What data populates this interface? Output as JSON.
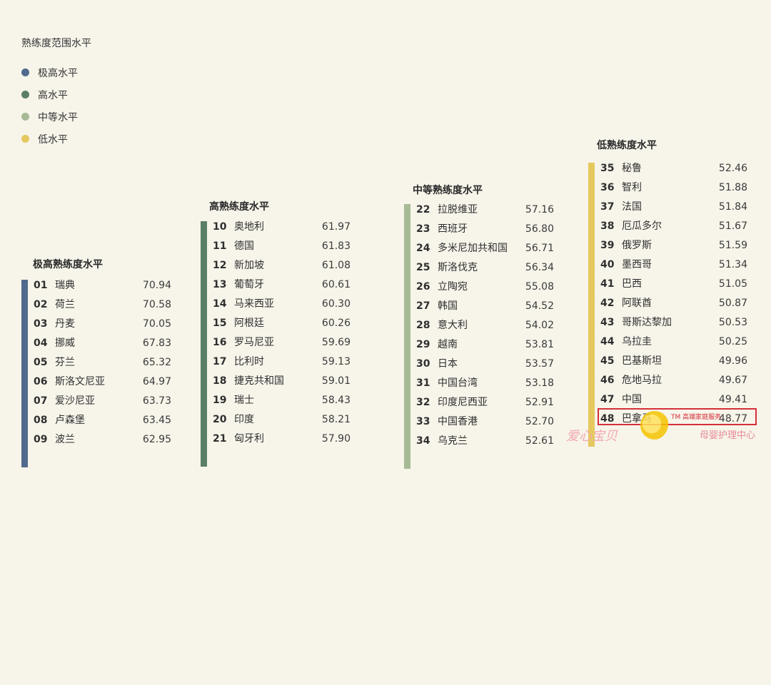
{
  "legend": {
    "title": "熟练度范围水平",
    "items": [
      {
        "label": "极高水平",
        "color": "#4f6a8c"
      },
      {
        "label": "高水平",
        "color": "#5a7f68"
      },
      {
        "label": "中等水平",
        "color": "#a6ba95"
      },
      {
        "label": "低水平",
        "color": "#e5c95f"
      }
    ]
  },
  "chart_data": {
    "type": "bar",
    "groups": [
      {
        "title": "极高熟练度水平",
        "color": "#4f6a8c",
        "rows": [
          {
            "rank": "01",
            "country": "瑞典",
            "score": "70.94"
          },
          {
            "rank": "02",
            "country": "荷兰",
            "score": "70.58"
          },
          {
            "rank": "03",
            "country": "丹麦",
            "score": "70.05"
          },
          {
            "rank": "04",
            "country": "挪威",
            "score": "67.83"
          },
          {
            "rank": "05",
            "country": "芬兰",
            "score": "65.32"
          },
          {
            "rank": "06",
            "country": "斯洛文尼亚",
            "score": "64.97"
          },
          {
            "rank": "07",
            "country": "爱沙尼亚",
            "score": "63.73"
          },
          {
            "rank": "08",
            "country": "卢森堡",
            "score": "63.45"
          },
          {
            "rank": "09",
            "country": "波兰",
            "score": "62.95"
          }
        ]
      },
      {
        "title": "高熟练度水平",
        "color": "#5a7f68",
        "rows": [
          {
            "rank": "10",
            "country": "奥地利",
            "score": "61.97"
          },
          {
            "rank": "11",
            "country": "德国",
            "score": "61.83"
          },
          {
            "rank": "12",
            "country": "新加坡",
            "score": "61.08"
          },
          {
            "rank": "13",
            "country": "葡萄牙",
            "score": "60.61"
          },
          {
            "rank": "14",
            "country": "马来西亚",
            "score": "60.30"
          },
          {
            "rank": "15",
            "country": "阿根廷",
            "score": "60.26"
          },
          {
            "rank": "16",
            "country": "罗马尼亚",
            "score": "59.69"
          },
          {
            "rank": "17",
            "country": "比利时",
            "score": "59.13"
          },
          {
            "rank": "18",
            "country": "捷克共和国",
            "score": "59.01"
          },
          {
            "rank": "19",
            "country": "瑞士",
            "score": "58.43"
          },
          {
            "rank": "20",
            "country": "印度",
            "score": "58.21"
          },
          {
            "rank": "21",
            "country": "匈牙利",
            "score": "57.90"
          }
        ]
      },
      {
        "title": "中等熟练度水平",
        "color": "#a6ba95",
        "rows": [
          {
            "rank": "22",
            "country": "拉脱维亚",
            "score": "57.16"
          },
          {
            "rank": "23",
            "country": "西班牙",
            "score": "56.80"
          },
          {
            "rank": "24",
            "country": "多米尼加共和国",
            "score": "56.71"
          },
          {
            "rank": "25",
            "country": "斯洛伐克",
            "score": "56.34"
          },
          {
            "rank": "26",
            "country": "立陶宛",
            "score": "55.08"
          },
          {
            "rank": "27",
            "country": "韩国",
            "score": "54.52"
          },
          {
            "rank": "28",
            "country": "意大利",
            "score": "54.02"
          },
          {
            "rank": "29",
            "country": "越南",
            "score": "53.81"
          },
          {
            "rank": "30",
            "country": "日本",
            "score": "53.57"
          },
          {
            "rank": "31",
            "country": "中国台湾",
            "score": "53.18"
          },
          {
            "rank": "32",
            "country": "印度尼西亚",
            "score": "52.91"
          },
          {
            "rank": "33",
            "country": "中国香港",
            "score": "52.70"
          },
          {
            "rank": "34",
            "country": "乌克兰",
            "score": "52.61"
          }
        ]
      },
      {
        "title": "低熟练度水平",
        "color": "#e5c95f",
        "rows": [
          {
            "rank": "35",
            "country": "秘鲁",
            "score": "52.46"
          },
          {
            "rank": "36",
            "country": "智利",
            "score": "51.88"
          },
          {
            "rank": "37",
            "country": "法国",
            "score": "51.84"
          },
          {
            "rank": "38",
            "country": "厄瓜多尔",
            "score": "51.67"
          },
          {
            "rank": "39",
            "country": "俄罗斯",
            "score": "51.59"
          },
          {
            "rank": "40",
            "country": "墨西哥",
            "score": "51.34"
          },
          {
            "rank": "41",
            "country": "巴西",
            "score": "51.05"
          },
          {
            "rank": "42",
            "country": "阿联酋",
            "score": "50.87"
          },
          {
            "rank": "43",
            "country": "哥斯达黎加",
            "score": "50.53"
          },
          {
            "rank": "44",
            "country": "乌拉圭",
            "score": "50.25"
          },
          {
            "rank": "45",
            "country": "巴基斯坦",
            "score": "49.96"
          },
          {
            "rank": "46",
            "country": "危地马拉",
            "score": "49.67"
          },
          {
            "rank": "47",
            "country": "中国",
            "score": "49.41",
            "highlight": true
          },
          {
            "rank": "48",
            "country": "巴拿马",
            "score": "48.77"
          }
        ]
      }
    ]
  },
  "watermark": {
    "tm_text": "TM 高端家庭服务",
    "left_text": "爱心宝贝",
    "right_text": "母婴护理中心",
    "highlight_color": "#d4303a"
  }
}
